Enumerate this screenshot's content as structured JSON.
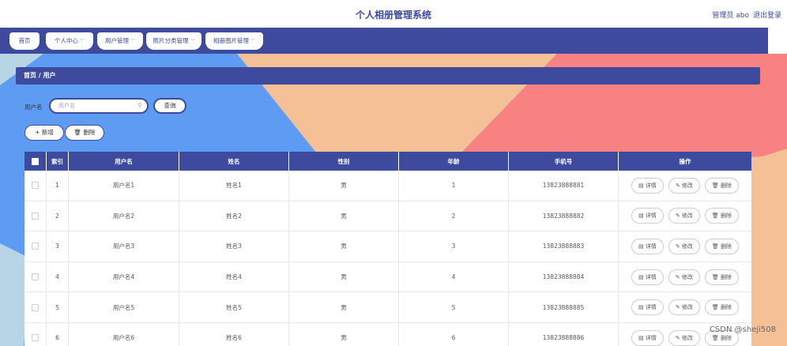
{
  "app_title": "个人相册管理系统",
  "user_info": "管理员 abo",
  "logout_label": "退出登录",
  "nav": [
    {
      "label": "首页",
      "has_dropdown": false
    },
    {
      "label": "个人中心",
      "has_dropdown": true
    },
    {
      "label": "用户管理",
      "has_dropdown": true
    },
    {
      "label": "照片分类管理",
      "has_dropdown": true
    },
    {
      "label": "相册图片管理",
      "has_dropdown": true
    }
  ],
  "breadcrumb": "首页 / 用户",
  "search": {
    "label": "用户名",
    "placeholder": "用户名",
    "button": "查询"
  },
  "actions": {
    "add": "+ 新增",
    "delete": "删除"
  },
  "table": {
    "headers": [
      "",
      "索引",
      "用户名",
      "姓名",
      "性别",
      "年龄",
      "手机号",
      "操作"
    ],
    "rows": [
      {
        "index": "1",
        "username": "用户名1",
        "name": "姓名1",
        "gender": "男",
        "age": "1",
        "phone": "13823888881"
      },
      {
        "index": "2",
        "username": "用户名2",
        "name": "姓名2",
        "gender": "男",
        "age": "2",
        "phone": "13823888882"
      },
      {
        "index": "3",
        "username": "用户名3",
        "name": "姓名3",
        "gender": "男",
        "age": "3",
        "phone": "13823888883"
      },
      {
        "index": "4",
        "username": "用户名4",
        "name": "姓名4",
        "gender": "男",
        "age": "4",
        "phone": "13823888884"
      },
      {
        "index": "5",
        "username": "用户名5",
        "name": "姓名5",
        "gender": "男",
        "age": "5",
        "phone": "13823888885"
      },
      {
        "index": "6",
        "username": "用户名6",
        "name": "姓名6",
        "gender": "男",
        "age": "6",
        "phone": "13823888886"
      }
    ],
    "row_actions": [
      "详情",
      "修改",
      "删除"
    ]
  },
  "watermark": "CSDN @sheji508",
  "colors": {
    "primary": "#3d4a9e",
    "bg_blue": "#5e9cf4",
    "bg_peach": "#f6c097",
    "bg_red": "#f88282"
  }
}
